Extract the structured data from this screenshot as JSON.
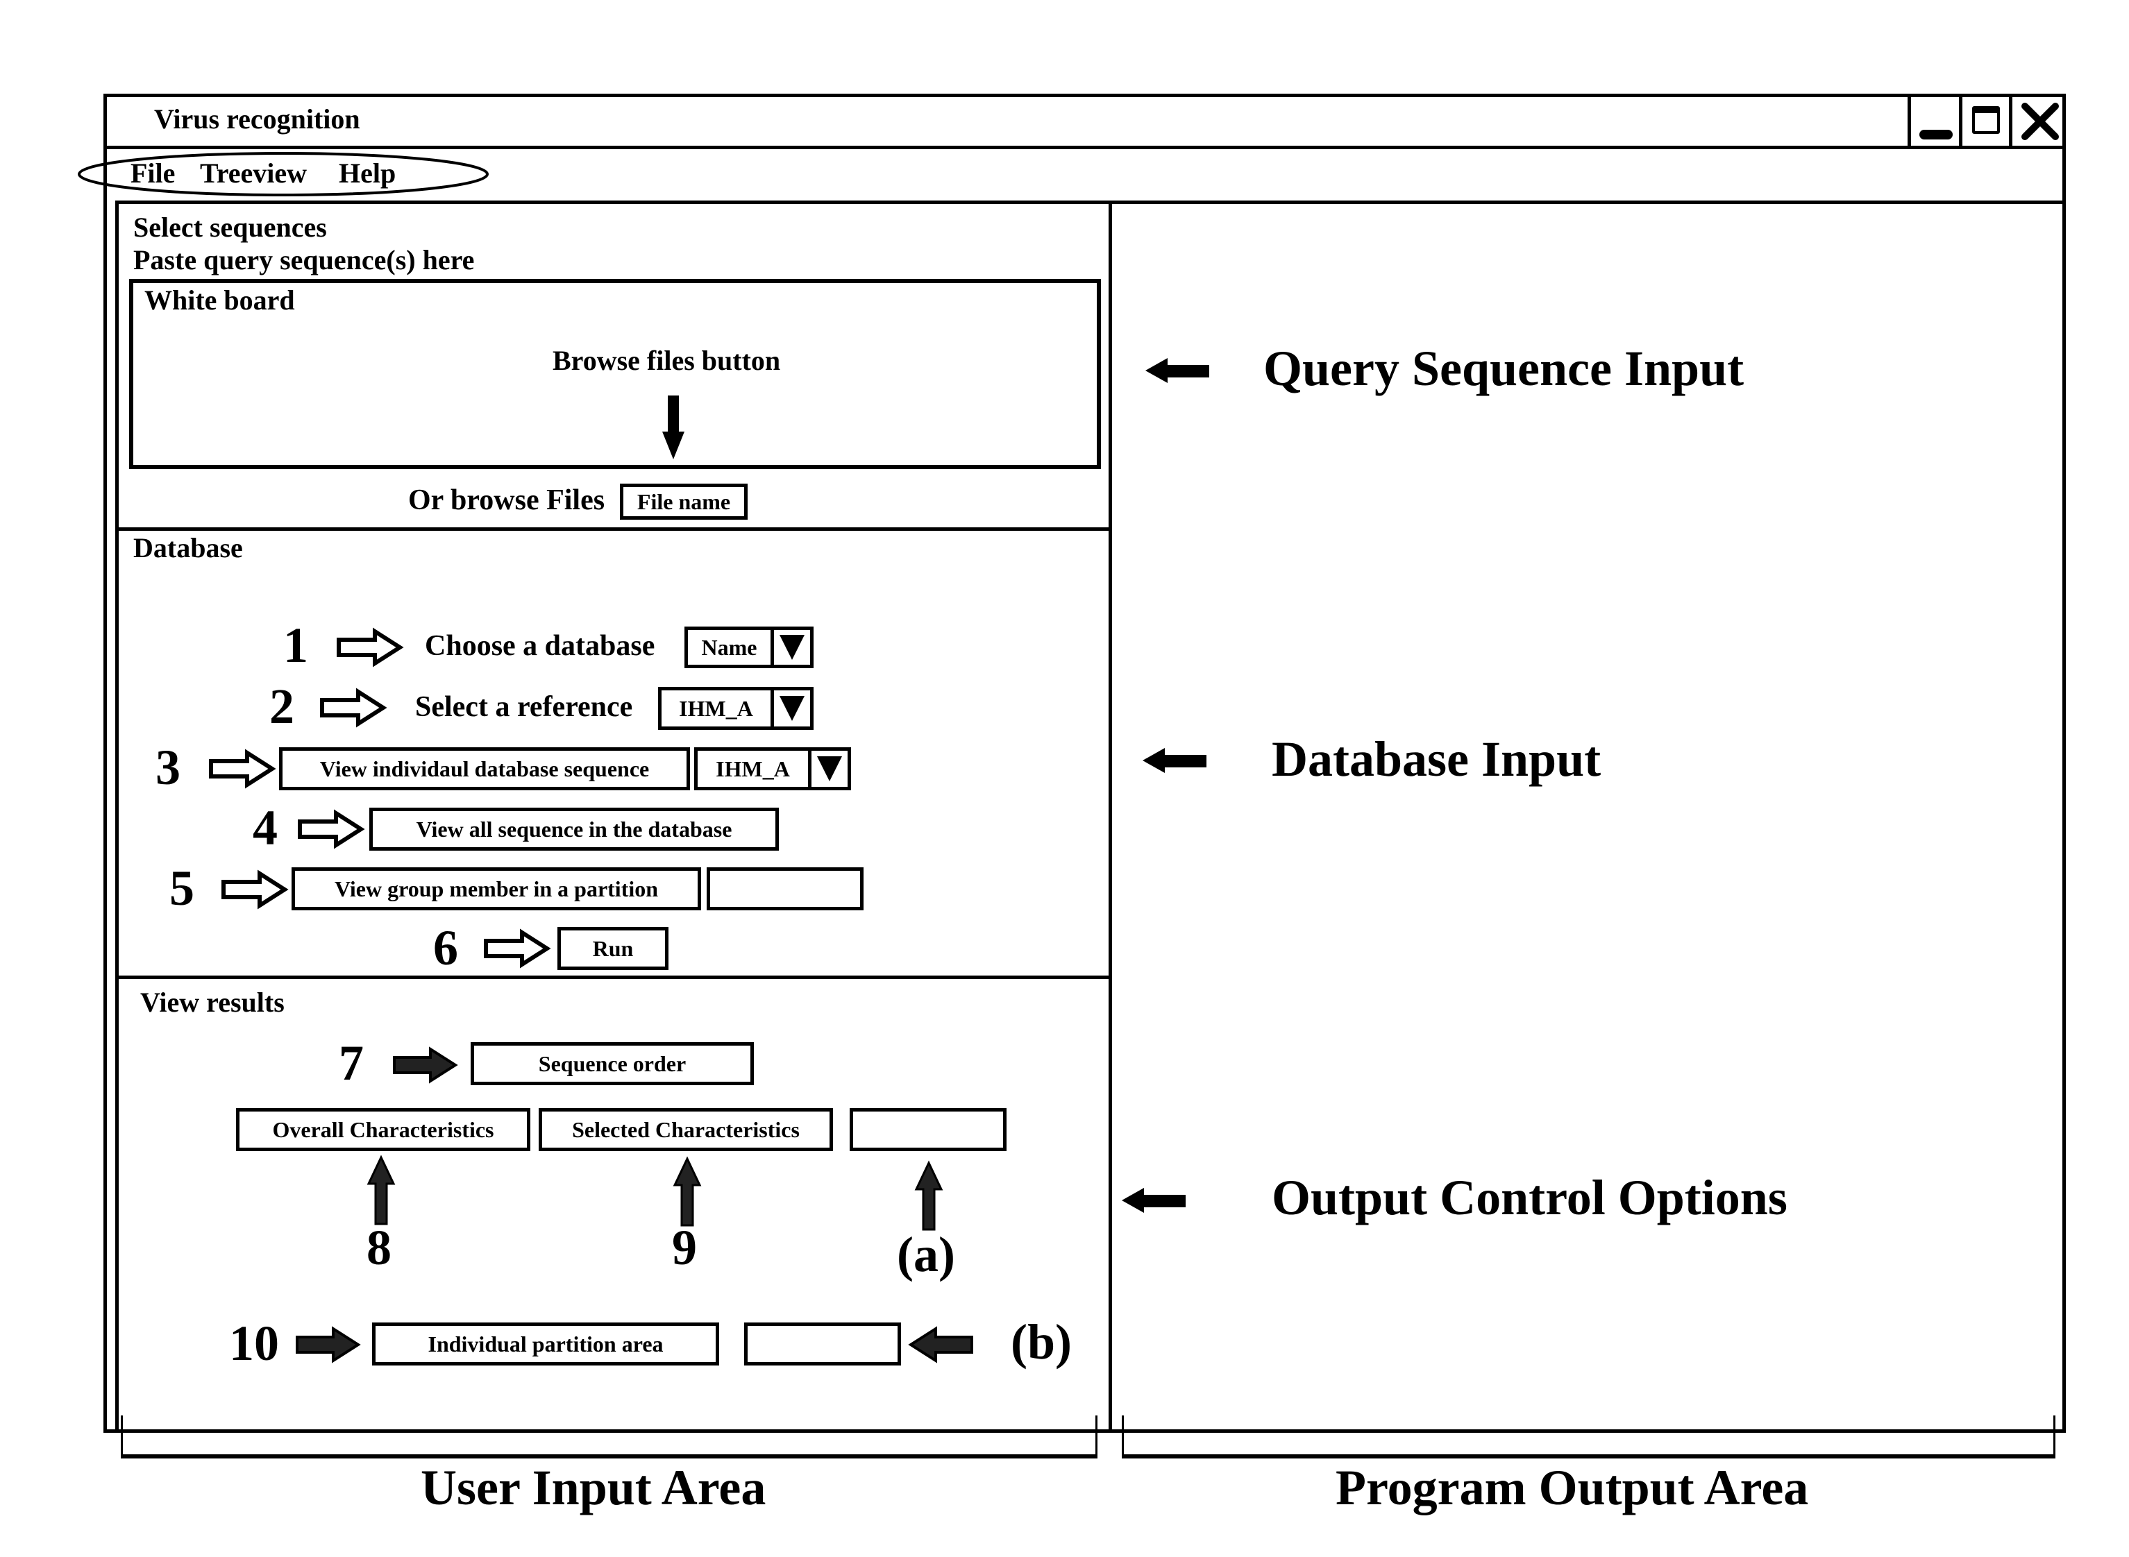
{
  "window": {
    "title": "Virus recognition",
    "controls": [
      "minimize",
      "maximize",
      "close"
    ]
  },
  "menu": {
    "items": [
      {
        "label": "File"
      },
      {
        "label": "Treeview"
      },
      {
        "label": "Help"
      }
    ]
  },
  "select_sequences": {
    "heading": "Select sequences",
    "instruction": "Paste query sequence(s) here",
    "whiteboard_label": "White board",
    "browse_annotation": "Browse files button",
    "browse_label": "Or browse Files",
    "file_button": "File name"
  },
  "database": {
    "heading": "Database",
    "steps": [
      {
        "number": "1",
        "label": "Choose a database",
        "select_value": "Name"
      },
      {
        "number": "2",
        "label": "Select a reference",
        "select_value": "IHM_A"
      },
      {
        "number": "3",
        "button": "View individaul database sequence",
        "select_value": "IHM_A"
      },
      {
        "number": "4",
        "button": "View all sequence in the database"
      },
      {
        "number": "5",
        "button": "View group member in a partition",
        "input_value": ""
      },
      {
        "number": "6",
        "button": "Run"
      }
    ]
  },
  "view_results": {
    "heading": "View results",
    "step7": {
      "number": "7",
      "button": "Sequence order"
    },
    "step8": {
      "number": "8",
      "button": "Overall Characteristics"
    },
    "step9": {
      "number": "9",
      "button": "Selected Characteristics"
    },
    "option_a": {
      "label": "(a)",
      "value": ""
    },
    "step10": {
      "number": "10",
      "button": "Individual partition area"
    },
    "option_b": {
      "label": "(b)",
      "value": ""
    }
  },
  "annotations": {
    "query_input": "Query Sequence Input",
    "database_input": "Database Input",
    "output_control": "Output Control Options",
    "user_input_area": "User Input Area",
    "program_output_area": "Program Output Area"
  }
}
